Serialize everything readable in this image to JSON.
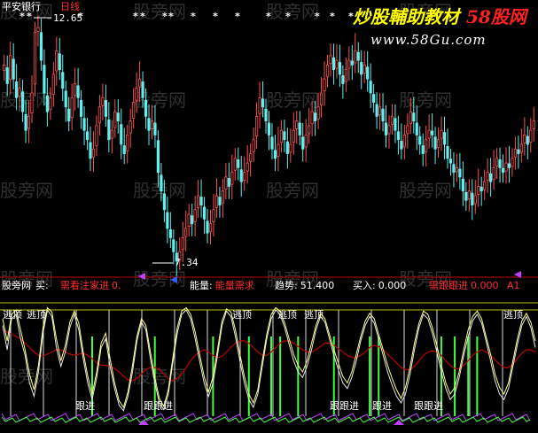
{
  "main_panel": {
    "title": "平安银行",
    "period": "日线",
    "high_price": "12.65",
    "low_price": "7.34",
    "star_glyph": "*",
    "brand_text": "炒股輔助教材",
    "brand_text_accent": "58股网",
    "brand_url": "www.58Gu.com"
  },
  "indicator_panel": {
    "name": "股旁网",
    "readouts": [
      {
        "label": "买:",
        "value": "",
        "color": "#ffffff"
      },
      {
        "label": "需看注家进",
        "value": "0.",
        "color": "#ff3030"
      },
      {
        "label": "能量:",
        "value": "能量需求",
        "color": "#ff3030"
      },
      {
        "label": "趋势:",
        "value": "51.400",
        "color": "#ffffff"
      },
      {
        "label": "买入:",
        "value": "0.000",
        "color": "#ffffff"
      },
      {
        "label": "需跟跟进",
        "value": "0.000",
        "color": "#ff3030"
      },
      {
        "label": "A1",
        "value": "",
        "color": "#ff3030"
      }
    ],
    "top_signals": [
      "逃顶",
      "逃顶",
      "逃顶",
      "逃顶",
      "逃顶",
      "逃顶"
    ],
    "bottom_signals": [
      "跟进",
      "跟跟进",
      "跟跟进",
      "跟进",
      "跟跟进"
    ]
  },
  "watermarks": [
    "股旁网",
    "股旁网",
    "股旁网",
    "股旁网",
    "股旁网",
    "股旁网",
    "股旁网",
    "股旁网",
    "股旁网",
    "股旁网",
    "股旁网",
    "股旁网",
    "股旁网",
    "股旁网",
    "股旁网",
    "股旁网",
    "股旁网",
    "股旁网"
  ],
  "colors": {
    "up": "#ff5050",
    "down": "#5ff0f0",
    "white_line": "#e8e8e8",
    "yellow_line": "#ffff80",
    "red_line": "#c00000",
    "green_bar": "#40ff40",
    "separator": "#c00000",
    "signal_text": "#ffffff",
    "brand": "#ffff00",
    "brand_accent": "#ff2020",
    "url": "#ffffff"
  },
  "chart_data": {
    "type": "candlestick",
    "price_range": [
      7.34,
      12.65
    ],
    "indicator_range": [
      0,
      100
    ],
    "closes": [
      11.6,
      11.2,
      11.8,
      11.3,
      10.9,
      11.1,
      10.6,
      10.2,
      10.5,
      11.0,
      12.3,
      12.4,
      11.7,
      11.0,
      10.6,
      10.9,
      11.4,
      11.9,
      11.5,
      11.1,
      10.7,
      10.4,
      10.9,
      11.2,
      10.9,
      10.5,
      10.2,
      10.0,
      9.6,
      9.8,
      10.3,
      10.7,
      10.9,
      10.5,
      10.0,
      10.2,
      10.6,
      10.4,
      9.9,
      9.7,
      10.1,
      10.4,
      10.8,
      11.1,
      11.3,
      10.9,
      10.5,
      10.2,
      10.4,
      10.1,
      9.3,
      8.9,
      8.5,
      8.1,
      7.9,
      7.6,
      7.4,
      7.6,
      7.9,
      8.1,
      8.4,
      8.2,
      8.5,
      8.8,
      8.6,
      8.3,
      8.0,
      8.2,
      8.5,
      8.8,
      8.6,
      8.9,
      9.2,
      9.0,
      9.3,
      9.6,
      9.4,
      9.1,
      9.3,
      9.5,
      9.7,
      10.0,
      10.5,
      10.9,
      10.7,
      10.4,
      10.1,
      9.8,
      9.6,
      9.9,
      10.2,
      10.0,
      9.7,
      9.9,
      10.2,
      10.4,
      10.1,
      9.8,
      10.1,
      10.3,
      10.6,
      10.4,
      10.7,
      11.0,
      11.3,
      11.6,
      11.8,
      11.5,
      11.7,
      11.4,
      11.2,
      11.5,
      11.7,
      11.6,
      11.9,
      11.7,
      11.4,
      11.6,
      11.3,
      11.0,
      10.8,
      10.5,
      10.7,
      10.4,
      10.1,
      10.3,
      10.5,
      10.2,
      10.0,
      9.8,
      10.1,
      10.3,
      10.6,
      10.4,
      10.1,
      9.9,
      9.7,
      10.0,
      10.2,
      10.1,
      9.8,
      10.0,
      10.2,
      9.9,
      9.6,
      9.5,
      9.3,
      9.4,
      9.2,
      8.9,
      8.7,
      8.9,
      8.6,
      8.8,
      9.0,
      8.9,
      9.1,
      9.3,
      9.1,
      9.4,
      9.6,
      9.4,
      9.3,
      9.5,
      9.4,
      9.6,
      9.8,
      9.7,
      9.9,
      10.1,
      9.9,
      10.2,
      10.4
    ],
    "white_line": [
      82,
      60,
      88,
      92,
      70,
      55,
      30,
      18,
      40,
      75,
      96,
      90,
      62,
      45,
      58,
      80,
      92,
      78,
      52,
      30,
      15,
      35,
      62,
      70,
      45,
      25,
      10,
      5,
      18,
      40,
      68,
      85,
      78,
      52,
      30,
      12,
      6,
      20,
      48,
      75,
      92,
      96,
      88,
      70,
      50,
      30,
      18,
      30,
      55,
      82,
      95,
      90,
      72,
      50,
      30,
      15,
      8,
      20,
      45,
      70,
      88,
      96,
      92,
      80,
      65,
      50,
      40,
      35,
      45,
      60,
      78,
      90,
      85,
      70,
      55,
      42,
      30,
      25,
      35,
      50,
      68,
      82,
      90,
      84,
      70,
      55,
      40,
      28,
      18,
      12,
      20,
      38,
      60,
      80,
      92,
      88,
      75,
      58,
      40,
      25,
      15,
      20,
      35,
      55,
      72,
      86,
      92,
      84,
      68,
      50,
      32,
      20,
      15,
      25,
      45,
      65,
      82,
      90,
      80,
      62
    ],
    "yellow_line": [
      88,
      68,
      92,
      96,
      78,
      60,
      38,
      24,
      46,
      80,
      98,
      94,
      70,
      50,
      64,
      85,
      95,
      84,
      58,
      36,
      20,
      40,
      66,
      75,
      52,
      30,
      14,
      8,
      22,
      46,
      72,
      88,
      82,
      58,
      35,
      16,
      9,
      24,
      52,
      80,
      95,
      98,
      92,
      76,
      56,
      36,
      22,
      36,
      60,
      86,
      97,
      94,
      78,
      56,
      36,
      20,
      12,
      24,
      50,
      74,
      92,
      98,
      95,
      84,
      70,
      56,
      46,
      40,
      50,
      66,
      82,
      93,
      88,
      74,
      60,
      48,
      36,
      30,
      40,
      56,
      72,
      86,
      93,
      88,
      74,
      60,
      46,
      34,
      24,
      16,
      26,
      44,
      66,
      84,
      95,
      92,
      80,
      64,
      46,
      30,
      20,
      26,
      40,
      60,
      78,
      90,
      95,
      88,
      72,
      56,
      38,
      26,
      20,
      30,
      50,
      70,
      86,
      93,
      85,
      68
    ],
    "red_line": [
      78,
      76,
      74,
      72,
      70,
      66,
      62,
      58,
      55,
      54,
      56,
      58,
      60,
      60,
      58,
      56,
      55,
      56,
      57,
      55,
      52,
      48,
      46,
      46,
      45,
      43,
      40,
      36,
      33,
      32,
      34,
      38,
      42,
      44,
      44,
      42,
      38,
      34,
      32,
      34,
      38,
      44,
      50,
      55,
      58,
      60,
      58,
      55,
      53,
      54,
      58,
      62,
      66,
      68,
      68,
      66,
      62,
      58,
      55,
      55,
      58,
      62,
      66,
      68,
      68,
      66,
      63,
      60,
      58,
      58,
      60,
      63,
      66,
      66,
      64,
      61,
      58,
      55,
      53,
      53,
      55,
      58,
      62,
      64,
      63,
      60,
      56,
      52,
      48,
      44,
      42,
      42,
      45,
      50,
      55,
      58,
      59,
      58,
      55,
      50,
      46,
      43,
      43,
      46,
      50,
      55,
      58,
      60,
      58,
      55,
      51,
      47,
      44,
      44,
      47,
      52,
      57,
      60,
      60,
      58
    ],
    "green_bars": [
      20,
      34,
      47,
      55,
      60,
      62,
      66,
      74,
      82,
      84,
      98,
      101,
      104,
      106
    ]
  }
}
